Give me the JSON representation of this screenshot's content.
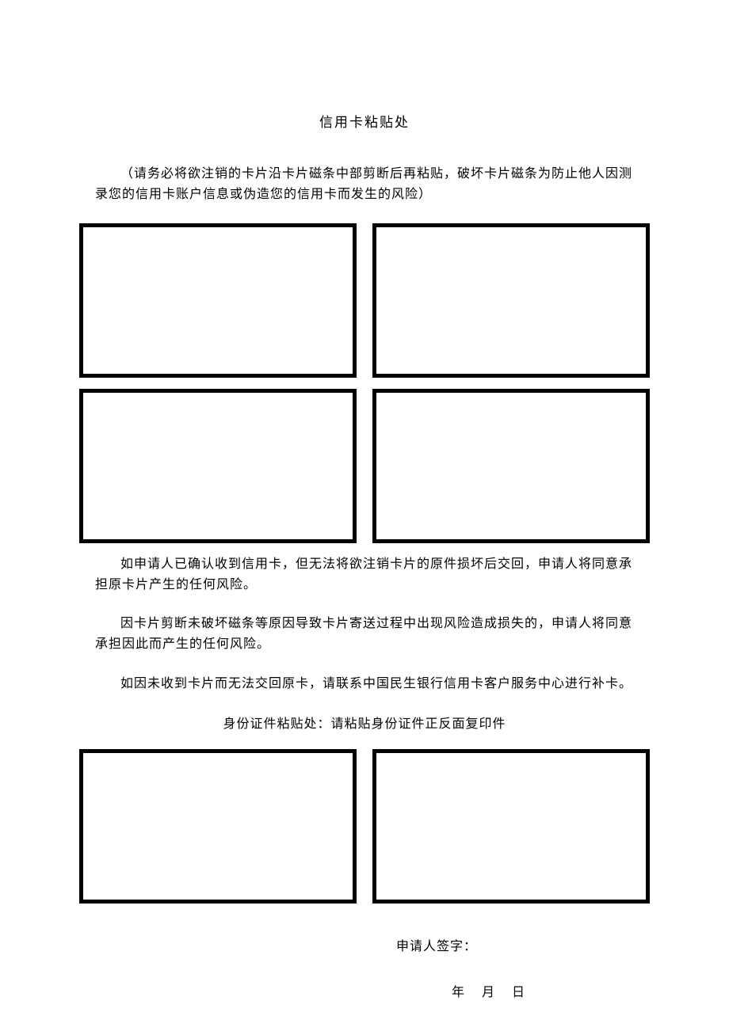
{
  "title": "信用卡粘贴处",
  "note": "（请务必将欲注销的卡片沿卡片磁条中部剪断后再粘贴，破坏卡片磁条为防止他人因测录您的信用卡账户信息或伪造您的信用卡而发生的风险）",
  "paragraphs": {
    "p1": "如申请人已确认收到信用卡，但无法将欲注销卡片的原件损坏后交回，申请人将同意承担原卡片产生的任何风险。",
    "p2": "因卡片剪断未破坏磁条等原因导致卡片寄送过程中出现风险造成损失的，申请人将同意承担因此而产生的任何风险。",
    "p3": "如因未收到卡片而无法交回原卡，请联系中国民生银行信用卡客户服务中心进行补卡。"
  },
  "id_title": "身份证件粘贴处：请粘贴身份证件正反面复印件",
  "signature": {
    "label": "申请人签字：",
    "date": "年　月　日"
  }
}
